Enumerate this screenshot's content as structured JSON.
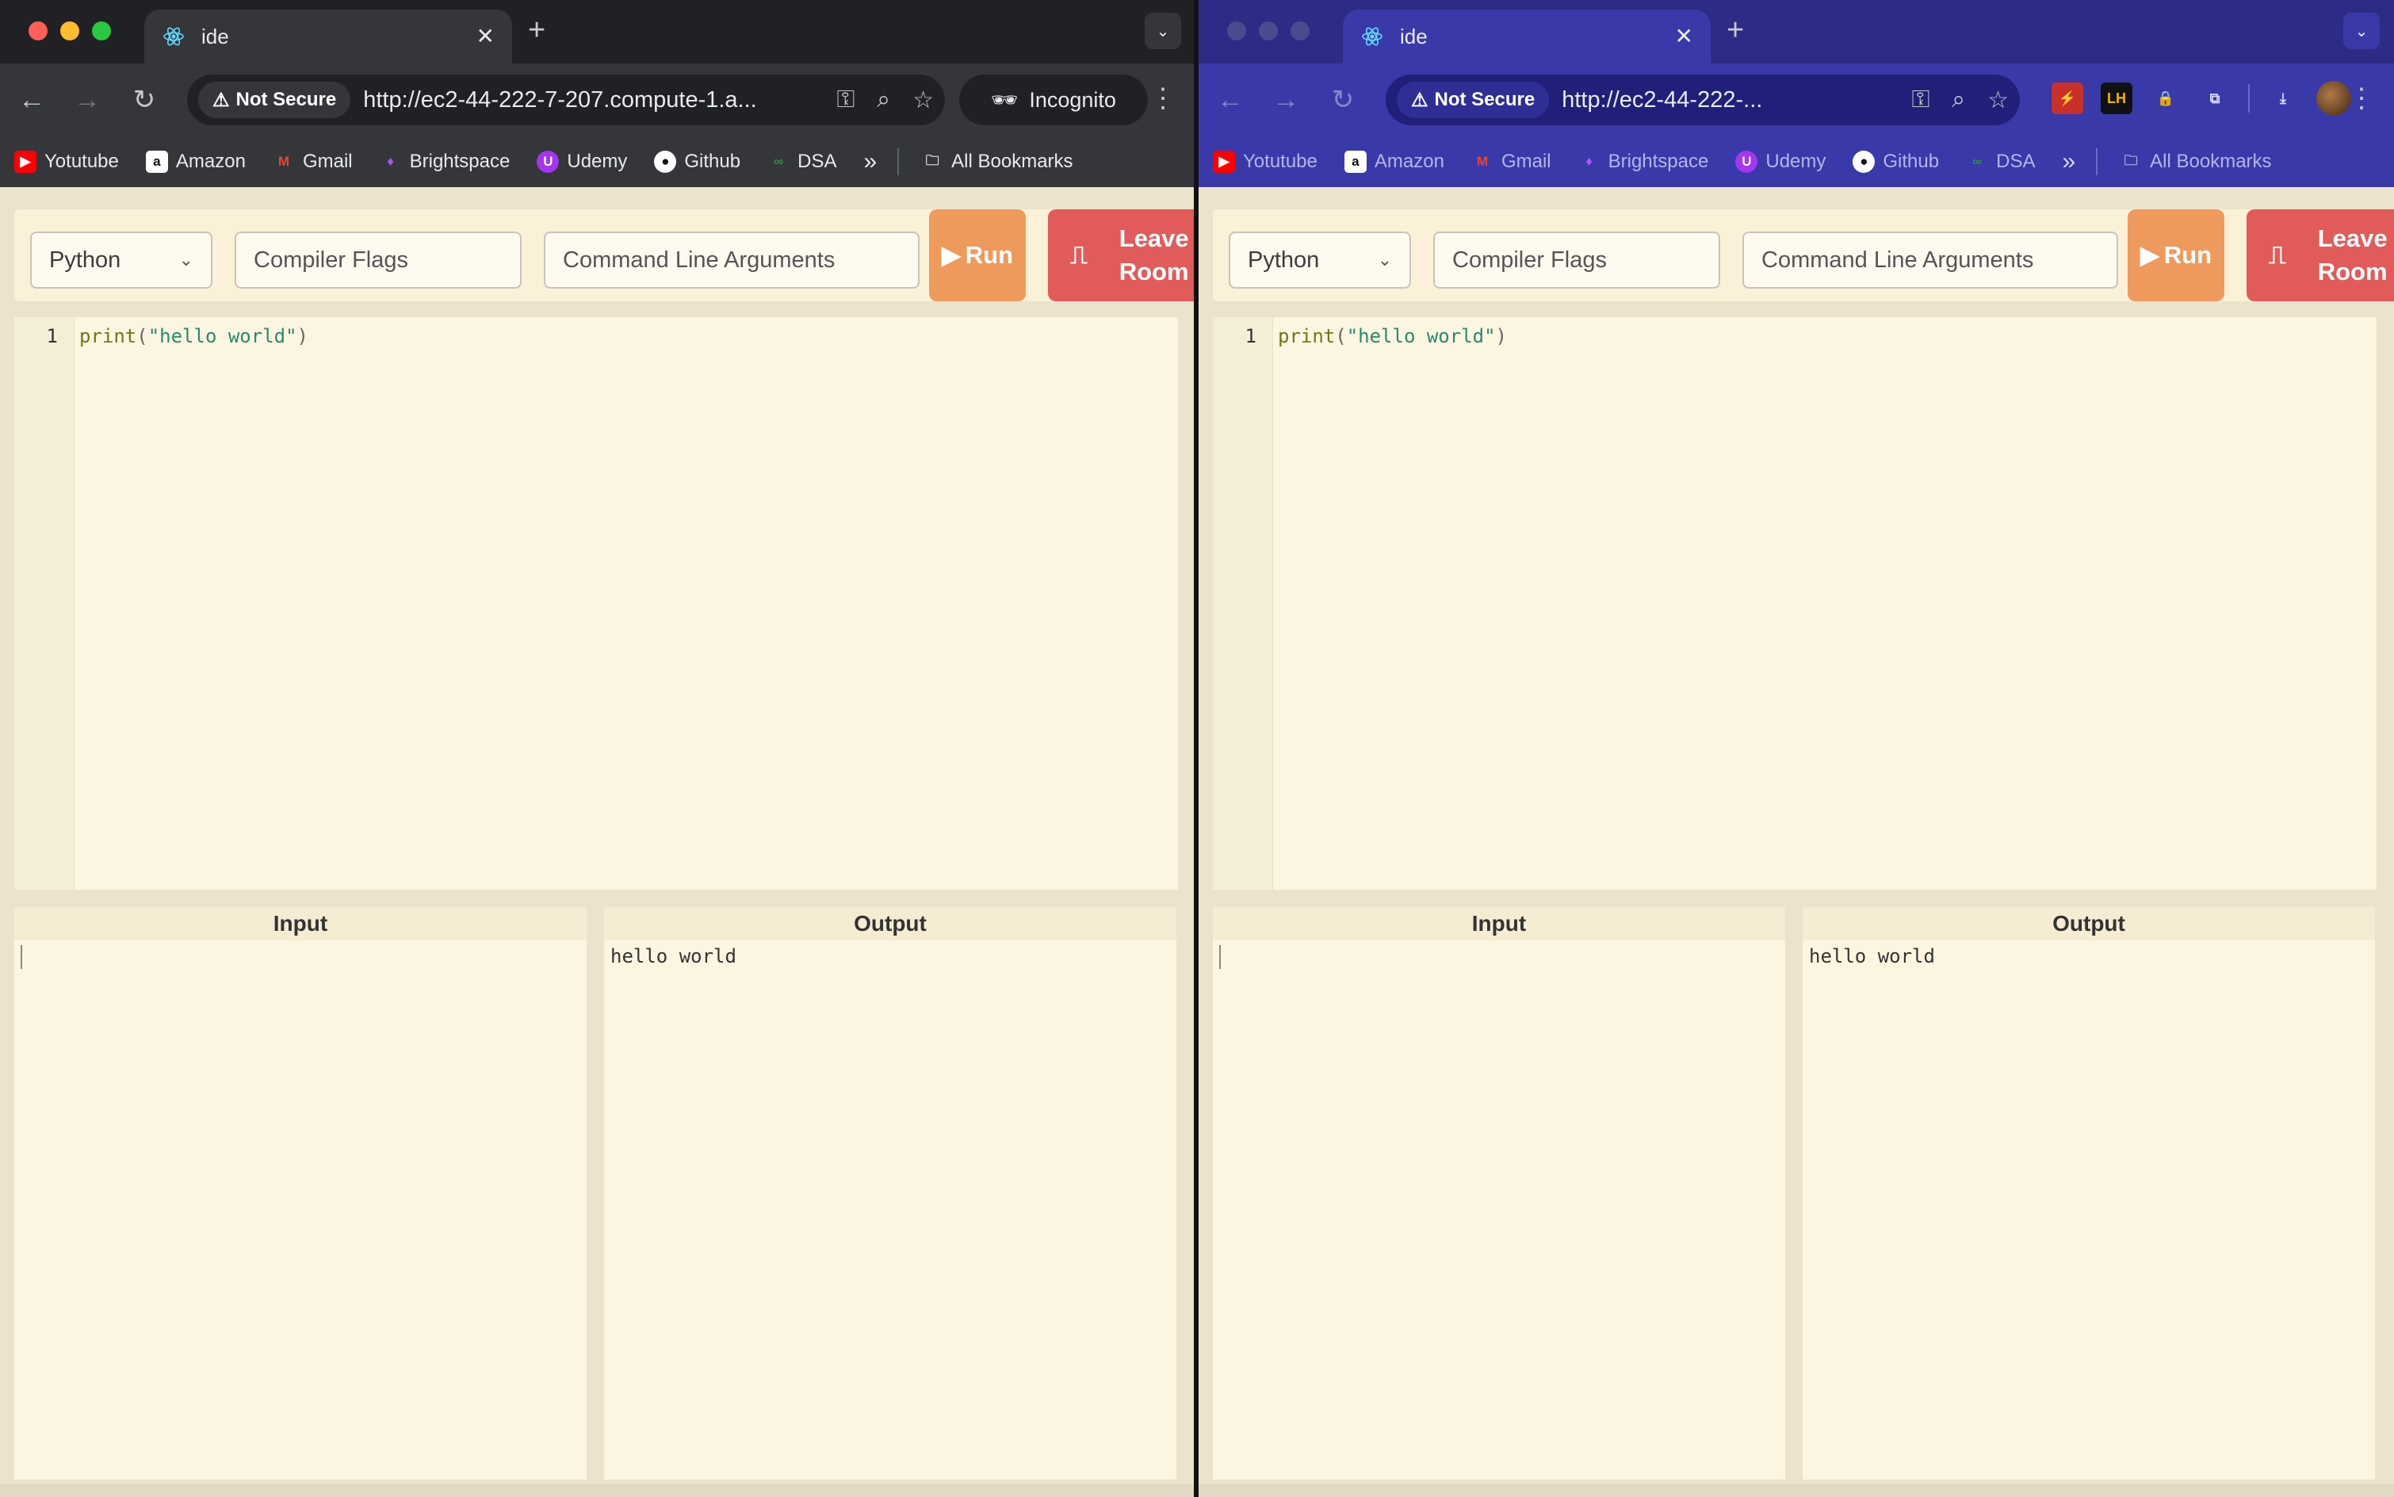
{
  "left_window": {
    "tab": {
      "title": "ide"
    },
    "omnibox": {
      "security_label": "Not Secure",
      "url": "http://ec2-44-222-7-207.compute-1.a..."
    },
    "profile_label": "Incognito"
  },
  "right_window": {
    "tab": {
      "title": "ide"
    },
    "omnibox": {
      "security_label": "Not Secure",
      "url": "http://ec2-44-222-..."
    },
    "extensions": [
      "wand-extension",
      "lighthouse-extension",
      "lock-extension",
      "extensions-puzzle",
      "downloads",
      "profile-avatar"
    ]
  },
  "bookmarks": {
    "items": [
      {
        "label": "Yotutube",
        "icon": "youtube-icon",
        "color": "#ff0000"
      },
      {
        "label": "Amazon",
        "icon": "amazon-icon",
        "color": "#ffffff"
      },
      {
        "label": "Gmail",
        "icon": "gmail-icon",
        "color": "#ea4335"
      },
      {
        "label": "Brightspace",
        "icon": "brightspace-icon",
        "color": "#a855f7"
      },
      {
        "label": "Udemy",
        "icon": "udemy-icon",
        "color": "#a435f0"
      },
      {
        "label": "Github",
        "icon": "github-icon",
        "color": "#ffffff"
      },
      {
        "label": "DSA",
        "icon": "dsa-icon",
        "color": "#2f8d46"
      }
    ],
    "all_bookmarks": "All Bookmarks"
  },
  "ide": {
    "language": "Python",
    "compiler_flags_placeholder": "Compiler Flags",
    "args_placeholder": "Command Line Arguments",
    "run_label": "Run",
    "leave_label_1": "Leave",
    "leave_label_2": "Room",
    "editor": {
      "line_number": "1",
      "code_fn": "print",
      "code_open": "(",
      "code_str": "\"hello world\"",
      "code_close": ")"
    },
    "input_title": "Input",
    "output_title": "Output",
    "output_text": "hello world"
  },
  "colors": {
    "run_button": "#ee9a5d",
    "leave_button": "#e15b5b",
    "page_bg": "#ece3cc",
    "editor_bg": "#fcf5e1"
  }
}
